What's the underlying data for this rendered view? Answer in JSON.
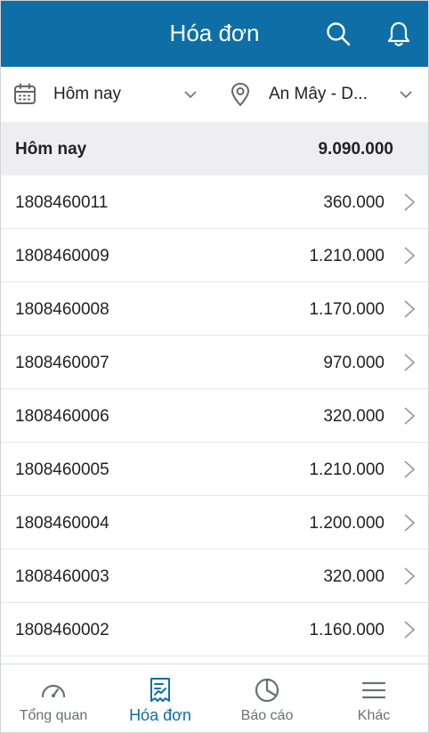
{
  "header": {
    "title": "Hóa đơn"
  },
  "filters": {
    "date_label": "Hôm nay",
    "store_label": "An Mây - D..."
  },
  "summary": {
    "label": "Hôm nay",
    "total": "9.090.000"
  },
  "invoices": [
    {
      "id": "1808460011",
      "amount": "360.000"
    },
    {
      "id": "1808460009",
      "amount": "1.210.000"
    },
    {
      "id": "1808460008",
      "amount": "1.170.000"
    },
    {
      "id": "1808460007",
      "amount": "970.000"
    },
    {
      "id": "1808460006",
      "amount": "320.000"
    },
    {
      "id": "1808460005",
      "amount": "1.210.000"
    },
    {
      "id": "1808460004",
      "amount": "1.200.000"
    },
    {
      "id": "1808460003",
      "amount": "320.000"
    },
    {
      "id": "1808460002",
      "amount": "1.160.000"
    }
  ],
  "tabs": [
    {
      "label": "Tổng quan",
      "icon": "speedometer-icon"
    },
    {
      "label": "Hóa đơn",
      "icon": "receipt-icon",
      "active": true
    },
    {
      "label": "Báo cáo",
      "icon": "pie-chart-icon"
    },
    {
      "label": "Khác",
      "icon": "menu-icon"
    }
  ],
  "colors": {
    "primary": "#0d6fa6",
    "summary_bg": "#eeeef2",
    "text": "#222222",
    "muted": "#6b6f74"
  }
}
